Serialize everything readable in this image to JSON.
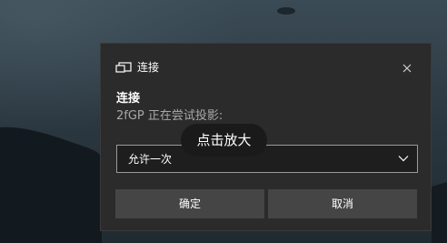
{
  "dialog": {
    "header_title": "连接",
    "cast_icon": "cast-screen-icon",
    "close_icon": "close-x-icon",
    "body_title": "连接",
    "body_description": "2fGP 正在尝试投影:",
    "permission_select": {
      "selected": "允许一次",
      "icon": "chevron-down-icon"
    },
    "confirm_label": "确定",
    "cancel_label": "取消"
  },
  "tooltip": {
    "text": "点击放大"
  },
  "colors": {
    "dialog_bg": "#2b2b2b",
    "button_bg": "#454545",
    "muted_text": "#a8a8a8",
    "select_border": "#9a9a9a"
  }
}
